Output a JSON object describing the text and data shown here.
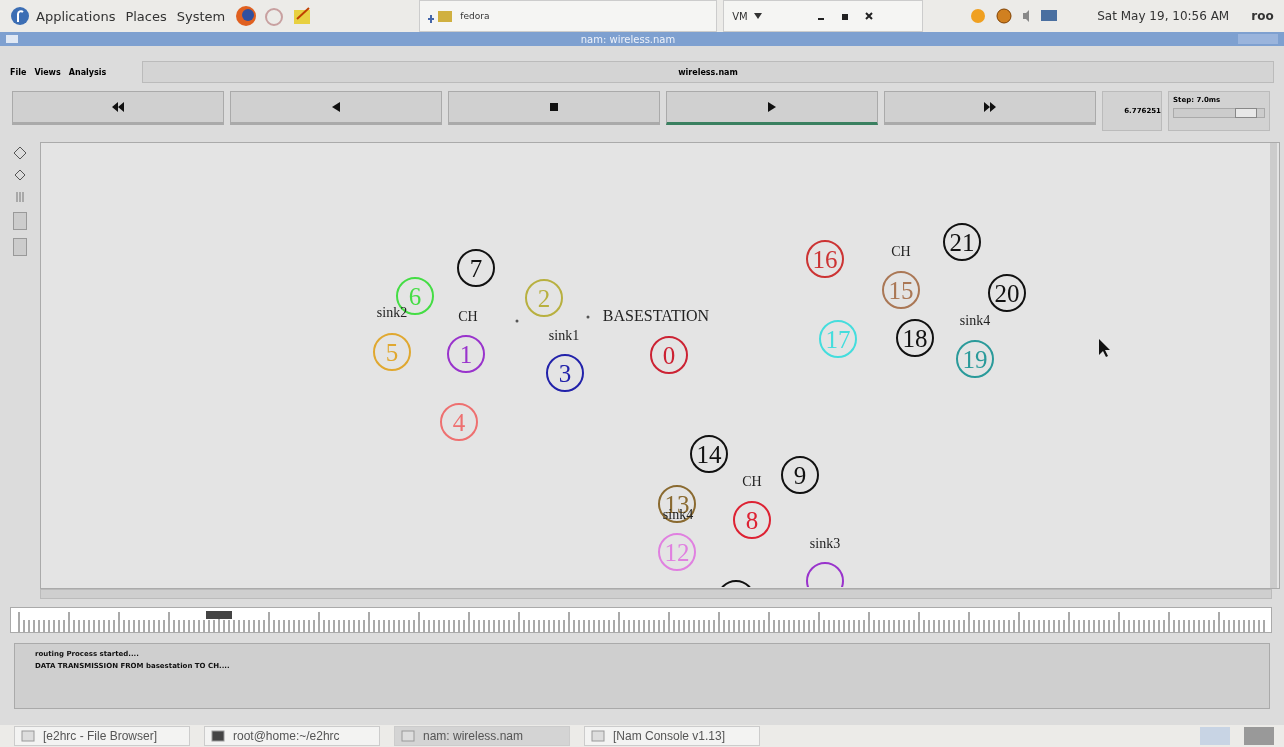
{
  "top_panel": {
    "menus": [
      "Applications",
      "Places",
      "System"
    ],
    "window_tab": "fedora",
    "vm_menu": "VM",
    "clock": "Sat May 19, 10:56 AM",
    "user": "roo"
  },
  "window": {
    "title": "nam: wireless.nam"
  },
  "menu_bar": {
    "items": [
      "File",
      "Views",
      "Analysis"
    ],
    "file_name": "wireless.nam"
  },
  "playback": {
    "buttons": [
      {
        "kind": "rewind",
        "selected": false
      },
      {
        "kind": "back",
        "selected": false
      },
      {
        "kind": "stop",
        "selected": false
      },
      {
        "kind": "play",
        "selected": true
      },
      {
        "kind": "forward",
        "selected": false
      }
    ],
    "time": "6.776251",
    "step": {
      "label": "Step: 7.0ms",
      "level": 0.8
    }
  },
  "canvas": {
    "nodes": [
      {
        "label": "7",
        "color": "#111111"
      },
      {
        "label": "16",
        "color": "#cc3333"
      },
      {
        "label": "21",
        "color": "#111111"
      },
      {
        "label": "6",
        "color": "#44dd44"
      },
      {
        "label": "2",
        "color": "#b8b040"
      },
      {
        "label": "15",
        "color": "#aa7755"
      },
      {
        "label": "20",
        "color": "#111111"
      },
      {
        "label": "5",
        "color": "#e0a830"
      },
      {
        "label": "1",
        "color": "#9933cc"
      },
      {
        "label": "3",
        "color": "#2222aa"
      },
      {
        "label": "0",
        "color": "#cc2233"
      },
      {
        "label": "17",
        "color": "#44dddd"
      },
      {
        "label": "18",
        "color": "#111111"
      },
      {
        "label": "19",
        "color": "#2a9a9a"
      },
      {
        "label": "4",
        "color": "#ee7070"
      },
      {
        "label": "14",
        "color": "#111111"
      },
      {
        "label": "9",
        "color": "#111111"
      },
      {
        "label": "13",
        "color": "#8a6a30"
      },
      {
        "label": "8",
        "color": "#dd2233"
      },
      {
        "label": "12",
        "color": "#e080e0"
      },
      {
        "color": "#111111"
      },
      {
        "color": "#9933cc"
      }
    ],
    "labels": [
      "CH",
      "sink2",
      "CH",
      "BASESTATION",
      "sink1",
      "sink4",
      "CH",
      "sink4",
      "sink3"
    ]
  },
  "log": [
    "routing Process started....",
    "DATA TRANSMISSION FROM basestation TO CH...."
  ],
  "taskbar": [
    {
      "label": "[e2hrc - File Browser]",
      "selected": false
    },
    {
      "label": "root@home:~/e2hrc",
      "selected": false
    },
    {
      "label": "nam: wireless.nam",
      "selected": true
    },
    {
      "label": "[Nam Console v1.13]",
      "selected": false
    }
  ]
}
